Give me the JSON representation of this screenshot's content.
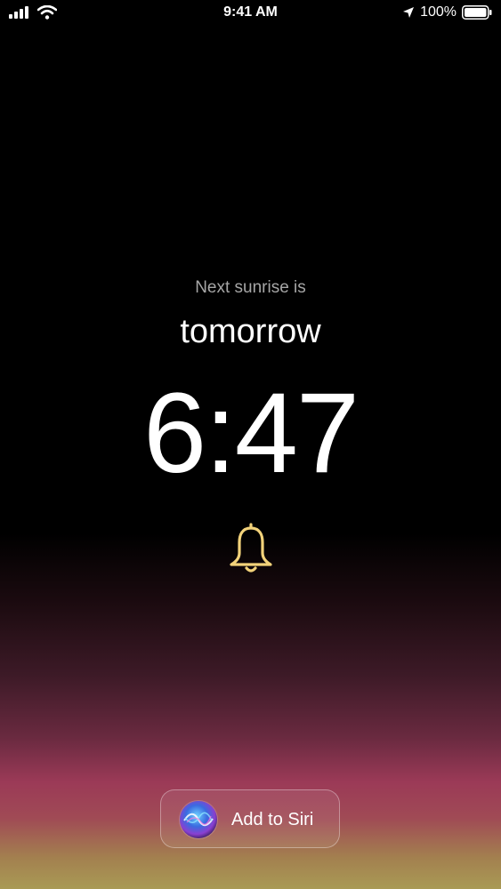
{
  "status_bar": {
    "time": "9:41 AM",
    "battery_percent": "100%",
    "icons": [
      "cellular-signal-icon",
      "wifi-icon",
      "location-arrow-icon",
      "battery-icon"
    ]
  },
  "main": {
    "subtitle": "Next sunrise is",
    "day": "tomorrow",
    "time": "6:47",
    "bell_icon": "bell-icon",
    "bell_color": "#f2d27a"
  },
  "siri": {
    "label": "Add to Siri",
    "icon": "siri-orb-icon"
  }
}
